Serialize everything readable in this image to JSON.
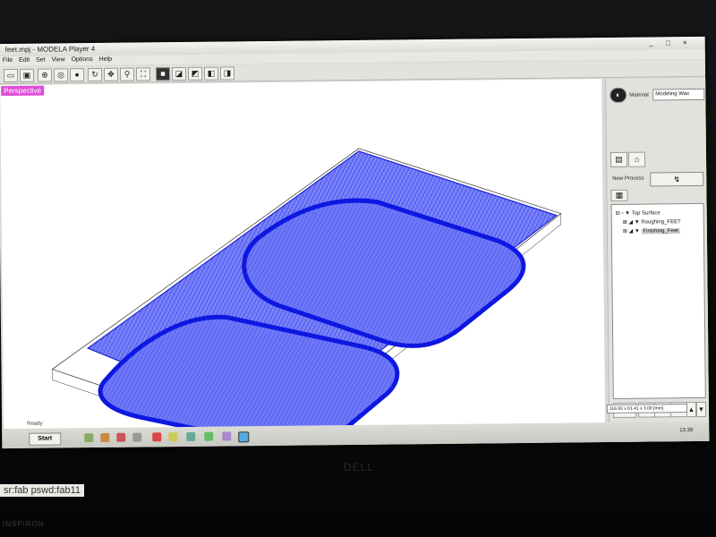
{
  "window": {
    "title": "feet.mpj - MODELA Player 4",
    "controls": "_ □ ×"
  },
  "menu": [
    "File",
    "Edit",
    "Set",
    "View",
    "Options",
    "Help"
  ],
  "toolbar": {
    "icons": [
      "open-icon",
      "save-icon",
      "view-all-icon",
      "zoom-in-icon",
      "zoom-out-icon",
      "rotate-icon",
      "pan-icon",
      "zoom-icon",
      "fit-icon",
      "solid-view-icon",
      "top-view-icon",
      "front-view-icon",
      "side-view-icon",
      "iso-view-icon"
    ]
  },
  "viewport": {
    "label": "Perspective"
  },
  "panel": {
    "material_label": "Material",
    "material_value": "Modeling Wax",
    "new_process_label": "New Process",
    "tree": [
      "Top Surface",
      "Roughing_FEET",
      "Finishing_Feet"
    ]
  },
  "status": {
    "readout": "116.92 x 61.41 x 3.00 [mm]",
    "ready": "Ready",
    "clock": "13:39"
  },
  "taskbar": {
    "start": "Start"
  },
  "bezel": {
    "brand": "DELL",
    "model": "INSPIRON"
  },
  "note": "sr:fab pswd:fab11",
  "colors": {
    "mesh": "#1e2cff",
    "highlight": "#e050d8"
  }
}
